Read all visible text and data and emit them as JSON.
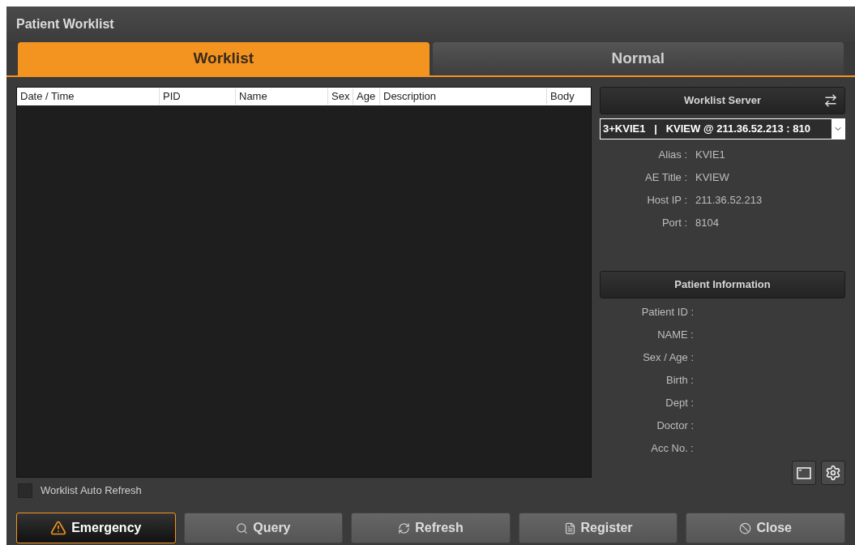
{
  "window": {
    "title": "Patient Worklist"
  },
  "tabs": [
    {
      "label": "Worklist",
      "selected": true
    },
    {
      "label": "Normal",
      "selected": false
    }
  ],
  "table": {
    "columns": [
      "Date / Time",
      "PID",
      "Name",
      "Sex",
      "Age",
      "Description",
      "Body"
    ]
  },
  "auto_refresh": {
    "label": "Worklist Auto Refresh",
    "checked": false
  },
  "server": {
    "title": "Worklist Server",
    "selection": "3+KVIE1   |   KVIEW @ 211.36.52.213 : 810",
    "fields": [
      {
        "label": "Alias :",
        "value": "KVIE1"
      },
      {
        "label": "AE Title :",
        "value": "KVIEW"
      },
      {
        "label": "Host IP :",
        "value": "211.36.52.213"
      },
      {
        "label": "Port :",
        "value": "8104"
      }
    ]
  },
  "patient": {
    "title": "Patient Information",
    "fields": [
      "Patient ID :",
      "NAME :",
      "Sex / Age :",
      "Birth :",
      "Dept :",
      "Doctor :",
      "Acc No. :"
    ]
  },
  "buttons": [
    {
      "kind": "emergency",
      "label": "Emergency"
    },
    {
      "kind": "query",
      "label": "Query"
    },
    {
      "kind": "refresh",
      "label": "Refresh"
    },
    {
      "kind": "register",
      "label": "Register"
    },
    {
      "kind": "close",
      "label": "Close"
    }
  ]
}
